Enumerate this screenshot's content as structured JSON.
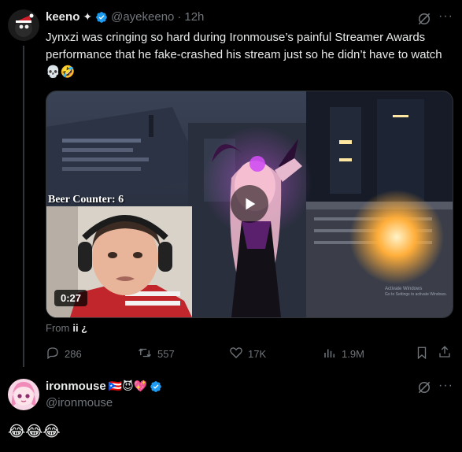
{
  "tweet": {
    "display_name": "keeno",
    "name_suffix": "✦",
    "handle": "@ayekeeno",
    "separator": "·",
    "time": "12h",
    "text": "Jynxzi was cringing so hard during Ironmouse’s painful Streamer Awards performance that he fake-crashed his stream just so he didn’t have to watch 💀🤣",
    "media": {
      "overlay_text": "Beer Counter: 6",
      "duration": "0:27",
      "watermark_line1": "Activate Windows",
      "watermark_line2": "Go to Settings to activate Windows."
    },
    "from_label": "From",
    "from_source": "ii ¿",
    "actions": {
      "replies": "286",
      "reposts": "557",
      "likes": "17K",
      "views": "1.9M"
    }
  },
  "reply": {
    "display_name": "ironmouse",
    "name_emojis": "🇵🇷😈💖",
    "handle": "@ironmouse",
    "text": "😂😂😂"
  },
  "icons": {
    "grok": "grok-icon",
    "more": "more-options-icon",
    "reply": "reply-icon",
    "repost": "repost-icon",
    "like": "like-icon",
    "views": "views-icon",
    "bookmark": "bookmark-icon",
    "share": "share-icon",
    "play": "play-icon",
    "verified": "verified-badge-icon"
  },
  "colors": {
    "background": "#000000",
    "text": "#e7e9ea",
    "secondary": "#71767b",
    "verified": "#1d9bf0",
    "play_bg": "rgba(0,0,0,0.55)"
  }
}
